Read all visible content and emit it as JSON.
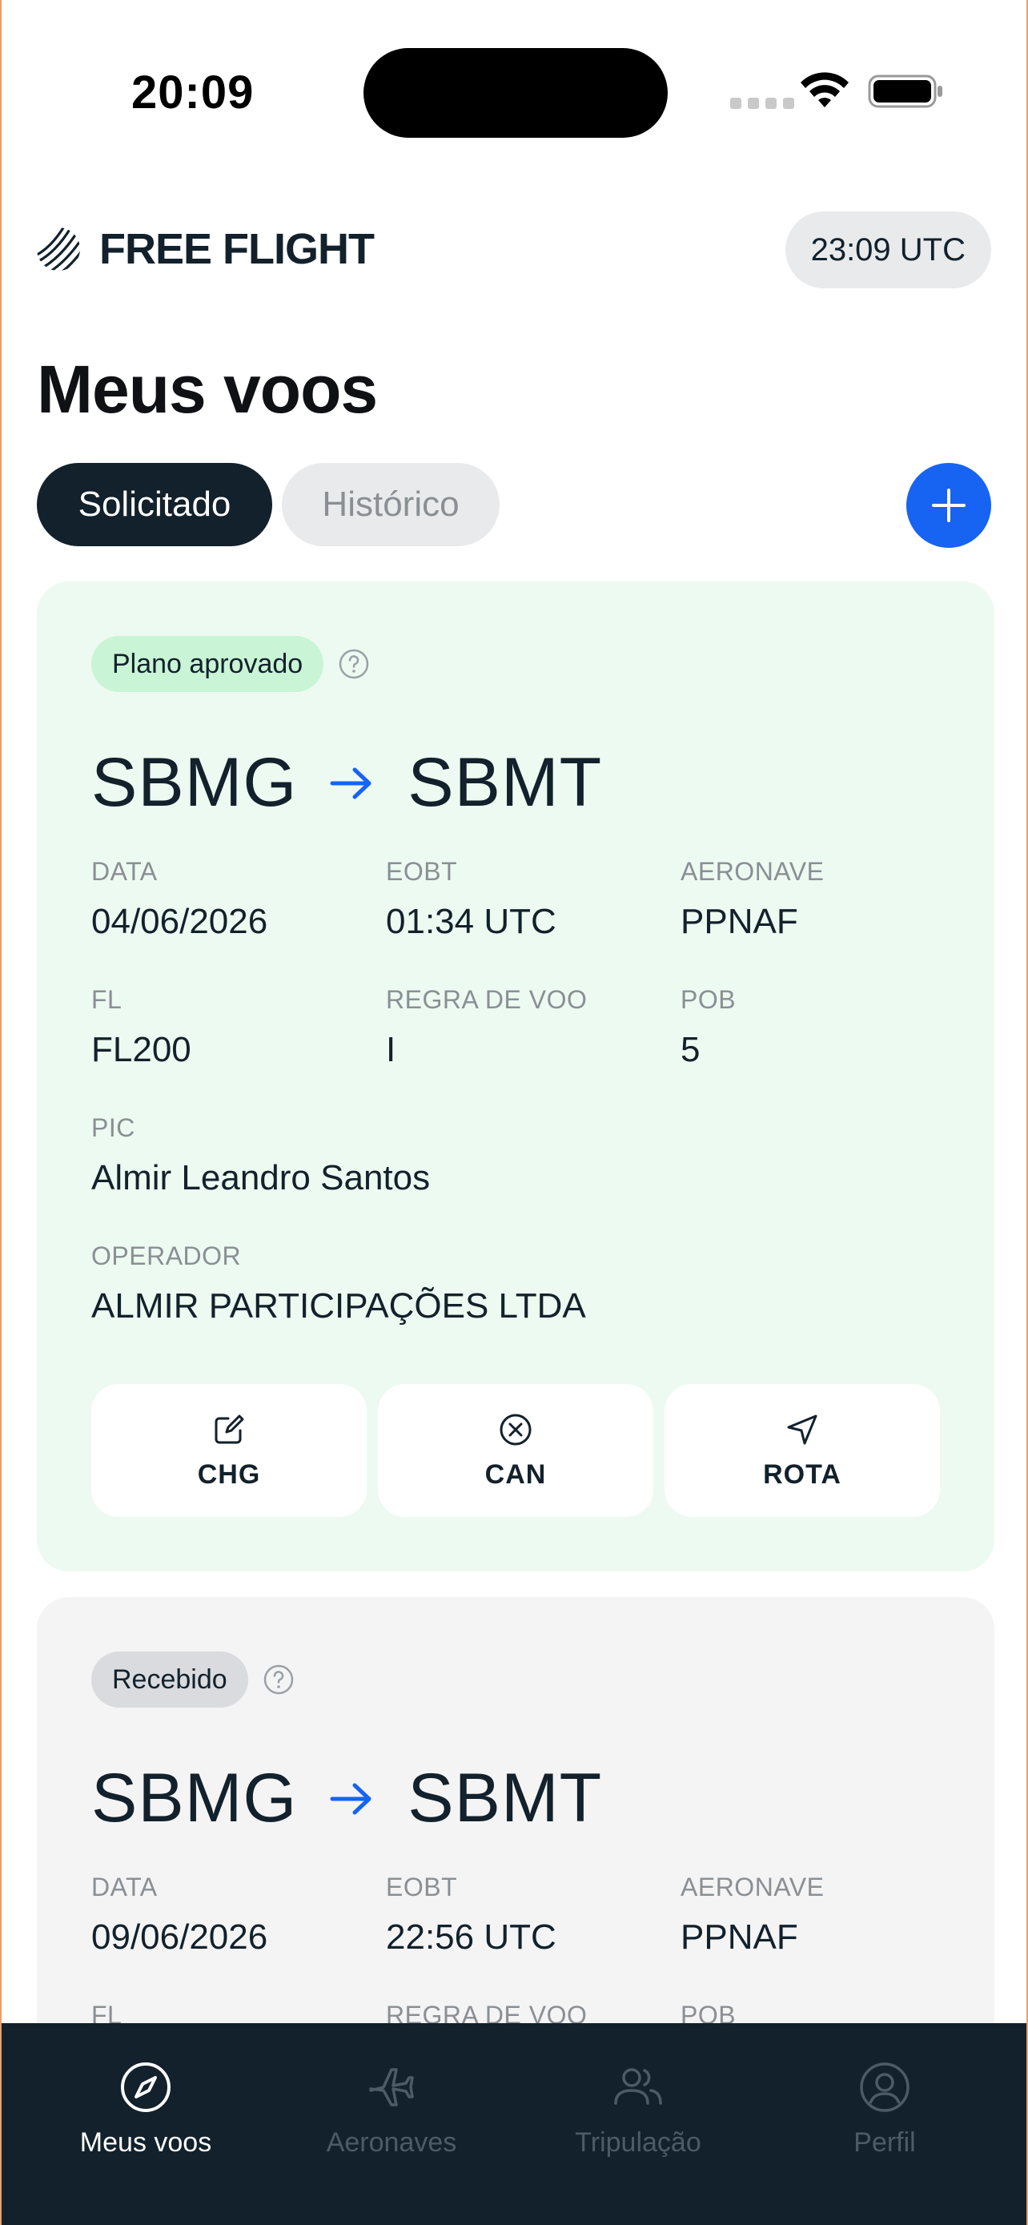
{
  "status_bar": {
    "time": "20:09"
  },
  "header": {
    "brand": "FREE FLIGHT",
    "utc_time": "23:09 UTC"
  },
  "page_title": "Meus voos",
  "tabs": [
    {
      "label": "Solicitado",
      "active": true
    },
    {
      "label": "Histórico",
      "active": false
    }
  ],
  "add_icon": "plus-icon",
  "flights": [
    {
      "status": "Plano aprovado",
      "status_color": "#c9f4d6",
      "origin": "SBMG",
      "destination": "SBMT",
      "fields": {
        "data_label": "DATA",
        "data": "04/06/2026",
        "eobt_label": "EOBT",
        "eobt": "01:34 UTC",
        "aeronave_label": "AERONAVE",
        "aeronave": "PPNAF",
        "fl_label": "FL",
        "fl": "FL200",
        "regra_label": "REGRA DE VOO",
        "regra": "I",
        "pob_label": "POB",
        "pob": "5",
        "pic_label": "PIC",
        "pic": "Almir Leandro Santos",
        "operador_label": "OPERADOR",
        "operador": "ALMIR PARTICIPAÇÕES LTDA"
      },
      "actions": [
        {
          "label": "CHG",
          "icon": "edit-icon"
        },
        {
          "label": "CAN",
          "icon": "cancel-circle-icon"
        },
        {
          "label": "ROTA",
          "icon": "navigation-icon"
        }
      ]
    },
    {
      "status": "Recebido",
      "status_color": "#d9dbde",
      "origin": "SBMG",
      "destination": "SBMT",
      "fields": {
        "data_label": "DATA",
        "data": "09/06/2026",
        "eobt_label": "EOBT",
        "eobt": "22:56 UTC",
        "aeronave_label": "AERONAVE",
        "aeronave": "PPNAF",
        "fl_label": "FL",
        "regra_label": "REGRA DE VOO",
        "pob_label": "POB"
      }
    }
  ],
  "bottom_nav": [
    {
      "label": "Meus voos",
      "icon": "compass-icon",
      "active": true
    },
    {
      "label": "Aeronaves",
      "icon": "airplane-icon",
      "active": false
    },
    {
      "label": "Tripulação",
      "icon": "users-icon",
      "active": false
    },
    {
      "label": "Perfil",
      "icon": "user-circle-icon",
      "active": false
    }
  ],
  "colors": {
    "accent": "#1763f2",
    "dark": "#12212b",
    "approved_card": "#edfaf1",
    "received_card": "#f4f4f5"
  }
}
